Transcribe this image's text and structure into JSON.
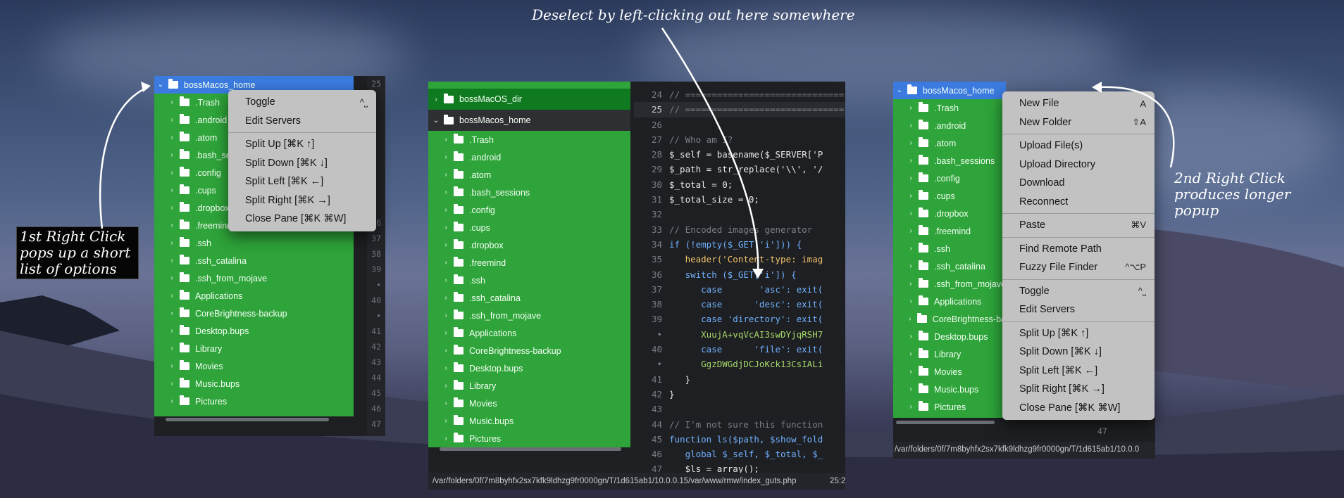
{
  "annotations": {
    "top": "Deselect by left-clicking out here somewhere",
    "left": "1st Right Click pops up a short list of options",
    "right": "2nd Right Click produces longer popup"
  },
  "left_panel": {
    "root": "bossMacos_home",
    "items": [
      ".Trash",
      ".android",
      ".atom",
      ".bash_sessions",
      ".config",
      ".cups",
      ".dropbox",
      ".freemind",
      ".ssh",
      ".ssh_catalina",
      ".ssh_from_mojave",
      "Applications",
      "CoreBrightness-backup",
      "Desktop.bups",
      "Library",
      "Movies",
      "Music.bups",
      "Pictures"
    ],
    "gutter": [
      "25",
      "",
      "",
      "",
      "",
      "",
      "",
      "",
      "",
      "36",
      "37",
      "38",
      "39",
      "•",
      "40",
      "•",
      "41",
      "42",
      "43",
      "44",
      "45",
      "46",
      "47"
    ]
  },
  "short_menu": {
    "items": [
      {
        "label": "Toggle",
        "shortcut": "^˽"
      },
      {
        "label": "Edit Servers",
        "shortcut": ""
      },
      {
        "sep": true
      },
      {
        "label": "Split Up [⌘K ↑]",
        "shortcut": ""
      },
      {
        "label": "Split Down [⌘K ↓]",
        "shortcut": ""
      },
      {
        "label": "Split Left [⌘K ←]",
        "shortcut": ""
      },
      {
        "label": "Split Right [⌘K →]",
        "shortcut": ""
      },
      {
        "label": "Close Pane [⌘K ⌘W]",
        "shortcut": ""
      }
    ]
  },
  "middle_panel": {
    "root1": "bossMacOS_dir",
    "root2": "bossMacos_home",
    "items": [
      ".Trash",
      ".android",
      ".atom",
      ".bash_sessions",
      ".config",
      ".cups",
      ".dropbox",
      ".freemind",
      ".ssh",
      ".ssh_catalina",
      ".ssh_from_mojave",
      "Applications",
      "CoreBrightness-backup",
      "Desktop.bups",
      "Library",
      "Movies",
      "Music.bups",
      "Pictures"
    ],
    "status_path": "/var/folders/0f/7m8byhfx2sx7kfk9ldhzg9fr0000gn/T/1d615ab1/10.0.0.15/var/www/rmw/index_guts.php",
    "status_pos": "25:2",
    "code_lines": [
      {
        "n": "24",
        "t": "// ==============================",
        "c": "cmt"
      },
      {
        "n": "25",
        "t": "// ==============================",
        "c": "cmt"
      },
      {
        "n": "26",
        "t": "",
        "c": ""
      },
      {
        "n": "27",
        "t": "// Who am I?",
        "c": "cmt"
      },
      {
        "n": "28",
        "t": "$_self = basename($_SERVER['P",
        "c": "var"
      },
      {
        "n": "29",
        "t": "$_path = str_replace('\\\\', '/",
        "c": "var"
      },
      {
        "n": "30",
        "t": "$_total = 0;",
        "c": "var"
      },
      {
        "n": "31",
        "t": "$_total_size = 0;",
        "c": "var"
      },
      {
        "n": "32",
        "t": "",
        "c": ""
      },
      {
        "n": "33",
        "t": "// Encoded images generator",
        "c": "cmt"
      },
      {
        "n": "34",
        "t": "if (!empty($_GET['i'])) {",
        "c": "kw"
      },
      {
        "n": "35",
        "t": "   header('Content-type: imag",
        "c": "fn"
      },
      {
        "n": "36",
        "t": "   switch ($_GET['i']) {",
        "c": "kw"
      },
      {
        "n": "37",
        "t": "      case       'asc': exit(",
        "c": "kw"
      },
      {
        "n": "38",
        "t": "      case      'desc': exit(",
        "c": "kw"
      },
      {
        "n": "39",
        "t": "      case 'directory': exit(",
        "c": "kw"
      },
      {
        "n": "•",
        "t": "      XuujA+vqVcAI3swDYjqRSH7",
        "c": "str"
      },
      {
        "n": "40",
        "t": "      case      'file': exit(",
        "c": "kw"
      },
      {
        "n": "•",
        "t": "      GgzDWGdjDCJoKck13CsIALi",
        "c": "str"
      },
      {
        "n": "41",
        "t": "   }",
        "c": "var"
      },
      {
        "n": "42",
        "t": "}",
        "c": "var"
      },
      {
        "n": "43",
        "t": "",
        "c": ""
      },
      {
        "n": "44",
        "t": "// I'm not sure this function",
        "c": "cmt"
      },
      {
        "n": "45",
        "t": "function ls($path, $show_fold",
        "c": "kw"
      },
      {
        "n": "46",
        "t": "   global $_self, $_total, $_",
        "c": "kw"
      },
      {
        "n": "47",
        "t": "   $ls = array();",
        "c": "var"
      }
    ]
  },
  "right_panel": {
    "root": "bossMacos_home",
    "items": [
      ".Trash",
      ".android",
      ".atom",
      ".bash_sessions",
      ".config",
      ".cups",
      ".dropbox",
      ".freemind",
      ".ssh",
      ".ssh_catalina",
      ".ssh_from_mojave",
      "Applications",
      "CoreBrightness-ba",
      "Desktop.bups",
      "Library",
      "Movies",
      "Music.bups",
      "Pictures"
    ],
    "status_path": "/var/folders/0f/7m8byhfx2sx7kfk9ldhzg9fr0000gn/T/1d615ab1/10.0.0",
    "line_number": "47"
  },
  "long_menu": {
    "items": [
      {
        "label": "New File",
        "shortcut": "A"
      },
      {
        "label": "New Folder",
        "shortcut": "⇧A"
      },
      {
        "sep": true
      },
      {
        "label": "Upload File(s)",
        "shortcut": ""
      },
      {
        "label": "Upload Directory",
        "shortcut": ""
      },
      {
        "label": "Download",
        "shortcut": ""
      },
      {
        "label": "Reconnect",
        "shortcut": ""
      },
      {
        "sep": true
      },
      {
        "label": "Paste",
        "shortcut": "⌘V"
      },
      {
        "sep": true
      },
      {
        "label": "Find Remote Path",
        "shortcut": ""
      },
      {
        "label": "Fuzzy File Finder",
        "shortcut": "^⌥P"
      },
      {
        "sep": true
      },
      {
        "label": "Toggle",
        "shortcut": "^˽"
      },
      {
        "label": "Edit Servers",
        "shortcut": ""
      },
      {
        "sep": true
      },
      {
        "label": "Split Up [⌘K ↑]",
        "shortcut": ""
      },
      {
        "label": "Split Down [⌘K ↓]",
        "shortcut": ""
      },
      {
        "label": "Split Left [⌘K ←]",
        "shortcut": ""
      },
      {
        "label": "Split Right [⌘K →]",
        "shortcut": ""
      },
      {
        "label": "Close Pane [⌘K ⌘W]",
        "shortcut": ""
      }
    ]
  }
}
